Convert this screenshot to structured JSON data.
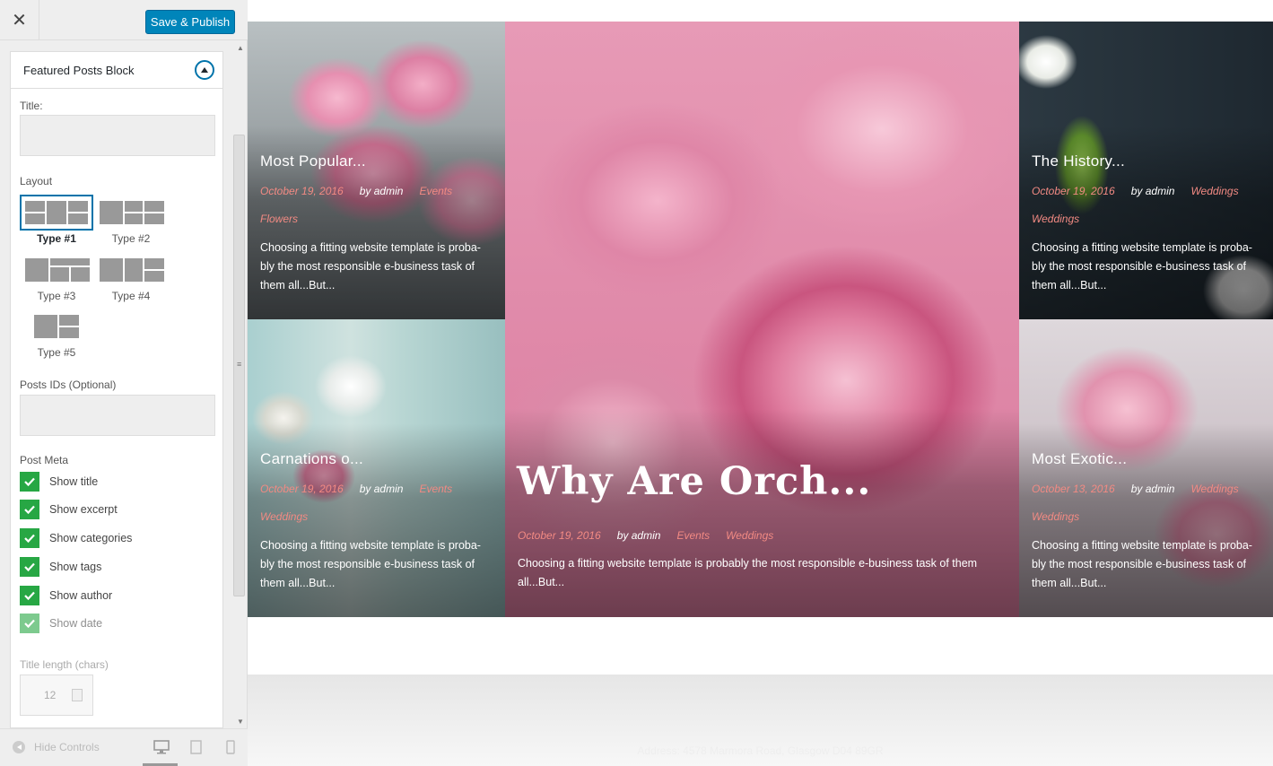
{
  "topbar": {
    "close_glyph": "✕",
    "publish_label": "Save & Publish"
  },
  "section": {
    "title": "Featured Posts Block"
  },
  "controls": {
    "title_label": "Title:",
    "title_value": "",
    "layout_label": "Layout",
    "layouts": [
      "Type #1",
      "Type #2",
      "Type #3",
      "Type #4",
      "Type #5"
    ],
    "layout_selected": "Type #1",
    "post_ids_label": "Posts IDs (Optional)",
    "post_ids_value": "",
    "post_meta_label": "Post Meta",
    "post_meta": [
      {
        "label": "Show title",
        "checked": true
      },
      {
        "label": "Show excerpt",
        "checked": true
      },
      {
        "label": "Show categories",
        "checked": true
      },
      {
        "label": "Show tags",
        "checked": true
      },
      {
        "label": "Show author",
        "checked": true
      },
      {
        "label": "Show date",
        "checked": true
      }
    ],
    "title_length_label": "Title length (chars)",
    "title_length_value": "12"
  },
  "footer": {
    "hide_controls": "Hide Controls",
    "devices": [
      "desktop-icon",
      "tablet-icon",
      "mobile-icon"
    ]
  },
  "colors": {
    "accent": "#0085ba",
    "check": "#27a744",
    "meta_link": "#f28a83"
  },
  "posts": [
    {
      "title": "Most Popular...",
      "date": "October 19, 2016",
      "author": "by admin",
      "categories": [
        "Events",
        "Flowers"
      ],
      "excerpt": "Choosing a fitting website template is proba-bly the most responsible e-business task of them all...But..."
    },
    {
      "title": "Carnations o...",
      "date": "October 19, 2016",
      "author": "by admin",
      "categories": [
        "Events",
        "Weddings"
      ],
      "excerpt": "Choosing a fitting website template is proba-bly the most responsible e-business task of them all...But..."
    },
    {
      "title": "Why Are Orch...",
      "date": "October 19, 2016",
      "author": "by admin",
      "categories": [
        "Events",
        "Weddings"
      ],
      "excerpt": "Choosing a fitting website template is probably the most responsible e-business task of them all...But..."
    },
    {
      "title": "The History...",
      "date": "October 19, 2016",
      "author": "by admin",
      "categories": [
        "Weddings",
        "Weddings"
      ],
      "excerpt": "Choosing a fitting website template is proba-bly the most responsible e-business task of them all...But..."
    },
    {
      "title": "Most Exotic...",
      "date": "October 13, 2016",
      "author": "by admin",
      "categories": [
        "Weddings",
        "Weddings"
      ],
      "excerpt": "Choosing a fitting website template is proba-bly the most responsible e-business task of them all...But..."
    }
  ],
  "site_footer": {
    "address": "Address: 4578 Marmora Road, Glasgow D04 89GR"
  }
}
